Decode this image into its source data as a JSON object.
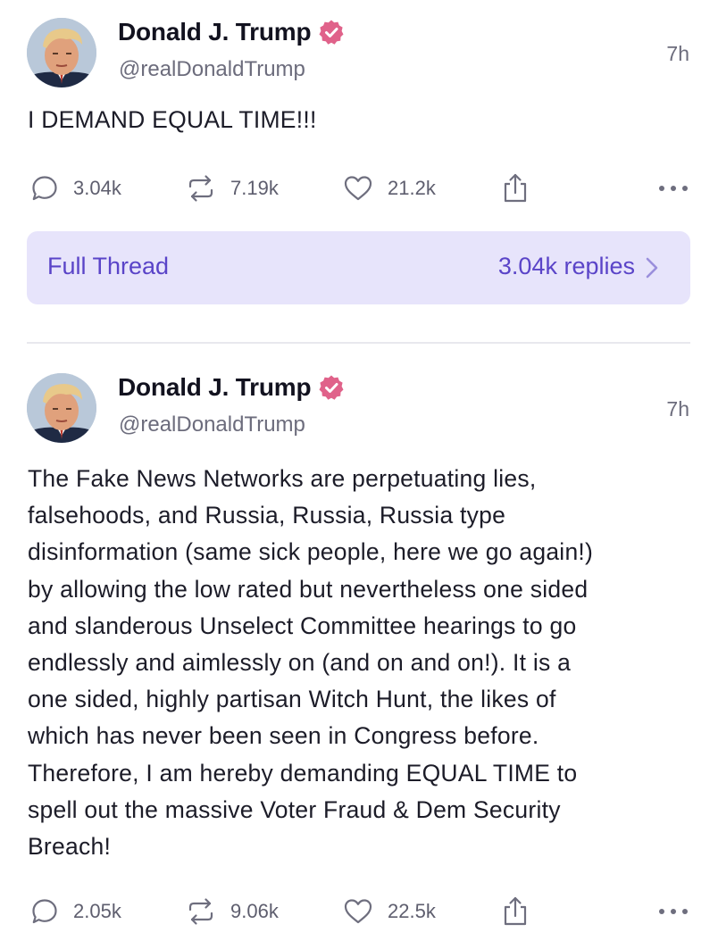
{
  "posts": [
    {
      "author_name": "Donald J. Trump",
      "author_handle": "@realDonaldTrump",
      "verified": true,
      "timestamp": "7h",
      "text": "I DEMAND EQUAL TIME!!!",
      "replies": "3.04k",
      "reposts": "7.19k",
      "likes": "21.2k",
      "icons": [
        "avatar",
        "verified-badge-icon",
        "reply-icon",
        "repost-icon",
        "like-icon",
        "share-icon",
        "more-icon"
      ]
    },
    {
      "author_name": "Donald J. Trump",
      "author_handle": "@realDonaldTrump",
      "verified": true,
      "timestamp": "7h",
      "text": "The Fake News Networks are perpetuating lies,\nfalsehoods, and Russia, Russia, Russia type\ndisinformation (same sick people, here we go again!)\nby allowing the low rated but nevertheless one sided\nand slanderous Unselect Committee hearings to go\nendlessly and aimlessly on (and on and on!). It is a\none sided, highly partisan Witch Hunt, the likes of\nwhich has never been seen in Congress before.\nTherefore, I am hereby demanding EQUAL TIME to\nspell out the massive Voter Fraud & Dem Security\nBreach!",
      "replies": "2.05k",
      "reposts": "9.06k",
      "likes": "22.5k",
      "icons": [
        "avatar",
        "verified-badge-icon",
        "reply-icon",
        "repost-icon",
        "like-icon",
        "share-icon",
        "more-icon"
      ]
    }
  ],
  "thread": {
    "label": "Full Thread",
    "replies_label": "3.04k replies",
    "icon": "chevron-right-icon"
  },
  "colors": {
    "accent": "#5a44c8",
    "verified_badge": "#e0628a",
    "thread_background": "#e7e4fb",
    "muted_text": "#6c6c7c",
    "icon_gray": "#6e6e7e"
  }
}
